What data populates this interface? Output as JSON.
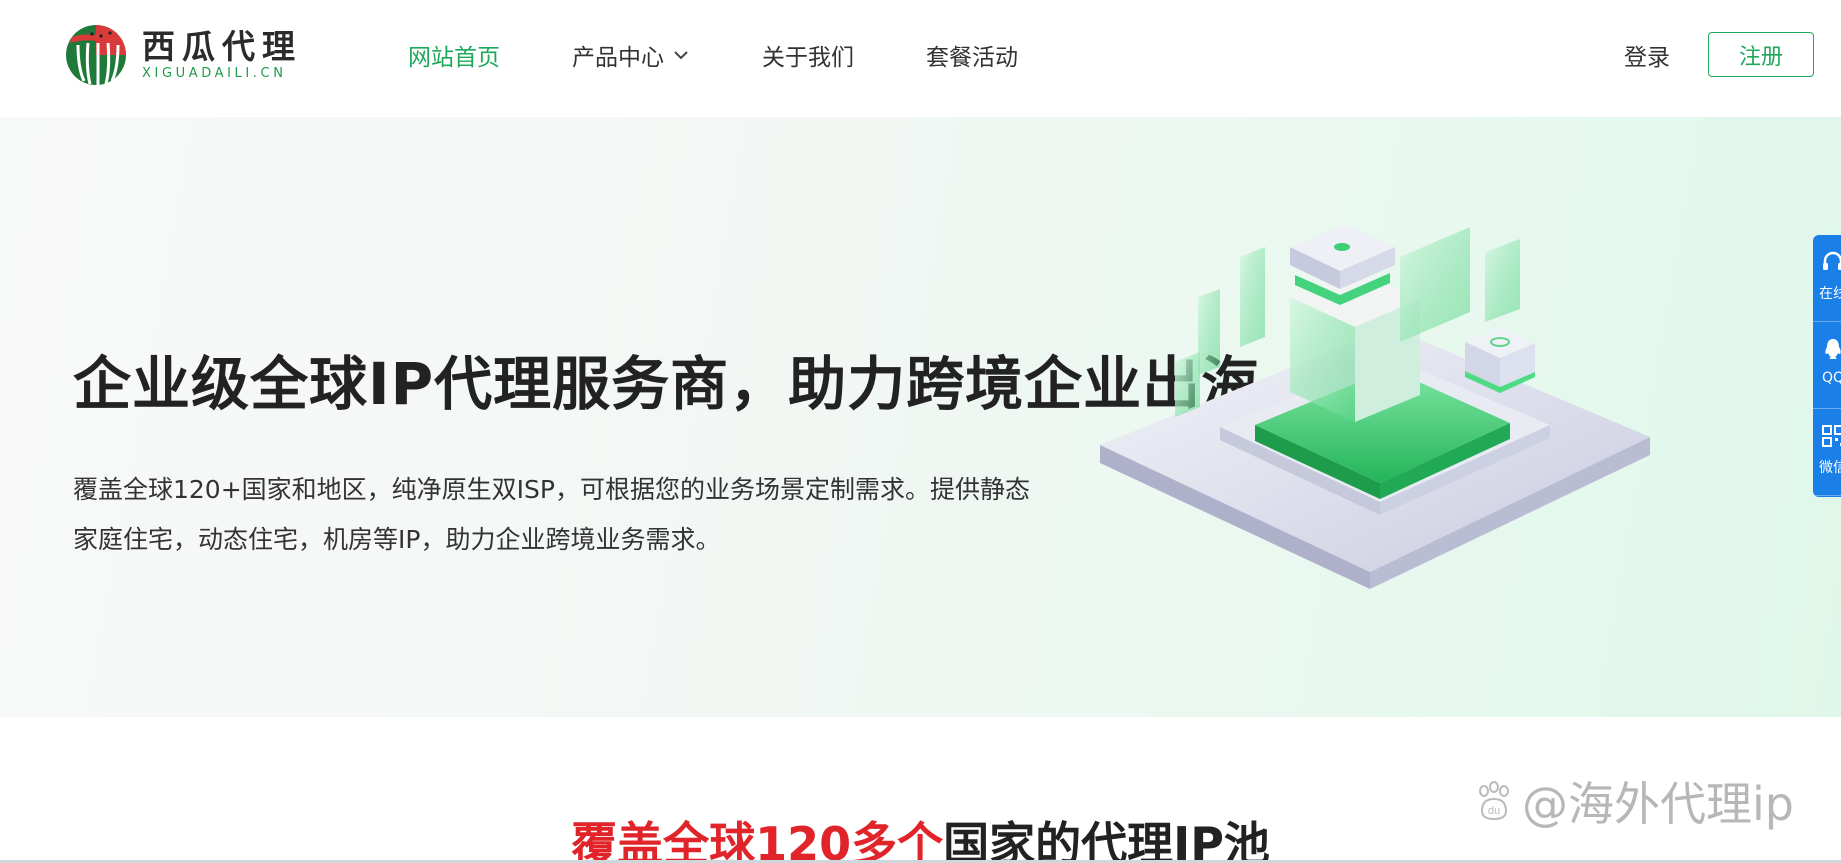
{
  "brand": {
    "name_cn": "西瓜代理",
    "name_en": "XIGUADAILI.CN",
    "colors": {
      "primary": "#1fa85a",
      "highlight": "#e0242a",
      "side_bar": "#1b7fe8"
    }
  },
  "nav": {
    "items": [
      {
        "label": "网站首页",
        "active": true
      },
      {
        "label": "产品中心",
        "has_dropdown": true
      },
      {
        "label": "关于我们"
      },
      {
        "label": "套餐活动"
      }
    ],
    "login_label": "登录",
    "register_label": "注册"
  },
  "hero": {
    "title": "企业级全球IP代理服务商，助力跨境企业出海",
    "description": "覆盖全球120+国家和地区，纯净原生双ISP，可根据您的业务场景定制需求。提供静态家庭住宅，动态住宅，机房等IP，助力企业跨境业务需求。"
  },
  "side_bar": {
    "items": [
      {
        "label": "在线",
        "icon": "headset-icon"
      },
      {
        "label": "QQ",
        "icon": "qq-icon"
      },
      {
        "label": "微信",
        "icon": "qrcode-icon"
      }
    ]
  },
  "section": {
    "title_highlight": "覆盖全球120多个",
    "title_rest": "国家的代理IP池"
  },
  "watermark": {
    "text": "@海外代理ip",
    "badge": "du"
  }
}
